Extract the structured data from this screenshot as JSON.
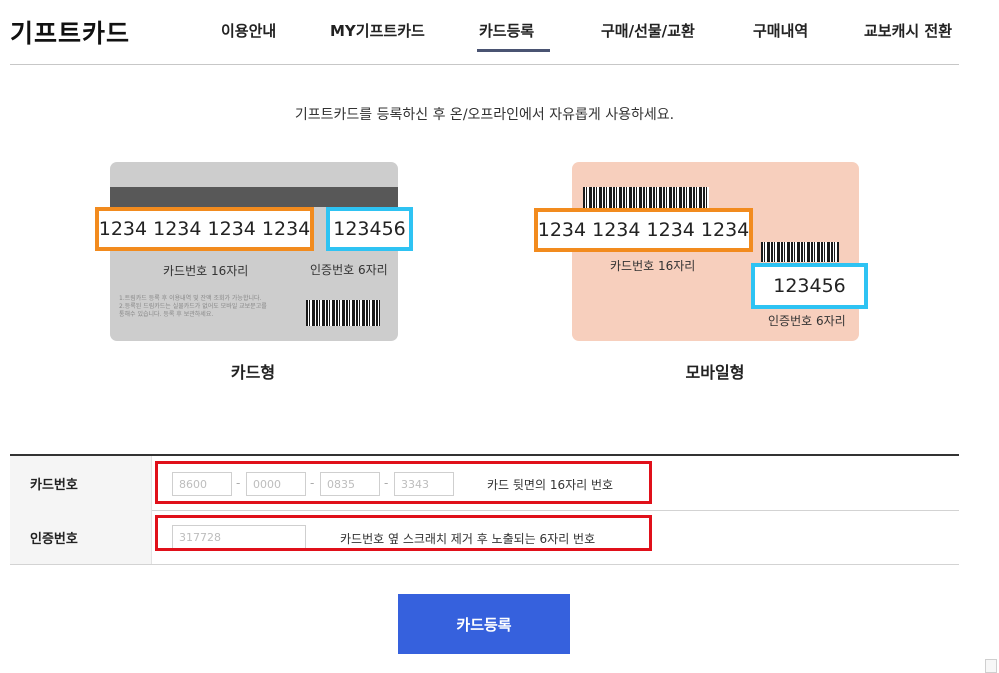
{
  "header": {
    "brand": "기프트카드",
    "nav": [
      {
        "label": "이용안내"
      },
      {
        "label": "MY기프트카드"
      },
      {
        "label": "카드등록",
        "active": true
      },
      {
        "label": "구매/선물/교환"
      },
      {
        "label": "구매내역"
      },
      {
        "label": "교보캐시 전환"
      }
    ]
  },
  "intro": "기프트카드를 등록하신 후 온/오프라인에서 자유롭게 사용하세요.",
  "physical_card": {
    "card_number": "1234 1234 1234 1234",
    "pin": "123456",
    "card_number_label": "카드번호 16자리",
    "pin_label": "인증번호 6자리",
    "caption": "카드형"
  },
  "mobile_card": {
    "card_number": "1234 1234 1234 1234",
    "pin": "123456",
    "card_number_label": "카드번호 16자리",
    "pin_label": "인증번호 6자리",
    "caption": "모바일형"
  },
  "form": {
    "card_number_label": "카드번호",
    "card_number_parts": [
      "8600",
      "0000",
      "0835",
      "3343"
    ],
    "card_number_hint": "카드 뒷면의 16자리 번호",
    "pin_label": "인증번호",
    "pin_value": "317728",
    "pin_hint": "카드번호 옆 스크래치 제거 후 노출되는 6자리 번호"
  },
  "submit_label": "카드등록",
  "colors": {
    "accent_button": "#3661dd",
    "card_number_frame": "#f28b1e",
    "pin_frame": "#2ec3f3",
    "highlight_box": "#e0101a",
    "mobile_card_bg": "#f7cfbd"
  }
}
